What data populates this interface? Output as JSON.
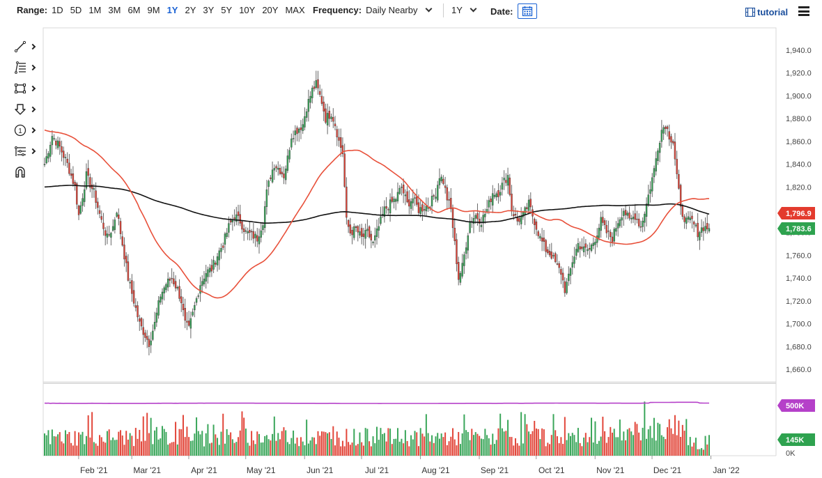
{
  "toolbar": {
    "range_label": "Range:",
    "ranges": [
      "1D",
      "5D",
      "1M",
      "3M",
      "6M",
      "9M",
      "1Y",
      "2Y",
      "3Y",
      "5Y",
      "10Y",
      "20Y",
      "MAX"
    ],
    "active_range": "1Y",
    "frequency_label": "Frequency:",
    "frequency_value": "Daily Nearby",
    "period_value": "1Y",
    "date_label": "Date:",
    "tutorial_label": "tutorial"
  },
  "drawing_tools": [
    "line-tool-icon",
    "fibonacci-tool-icon",
    "rectangle-tool-icon",
    "arrow-down-tool-icon",
    "annotation-tool-icon",
    "pitchfork-tool-icon",
    "magnet-tool-icon"
  ],
  "chart_data": {
    "type": "candlestick",
    "y_axis": {
      "min": 1660,
      "max": 1940,
      "ticks": [
        "1,660.0",
        "1,680.0",
        "1,700.0",
        "1,720.0",
        "1,740.0",
        "1,760.0",
        "1,780.0",
        "1,800.0",
        "1,820.0",
        "1,840.0",
        "1,860.0",
        "1,880.0",
        "1,900.0",
        "1,920.0",
        "1,940.0"
      ],
      "tick_values": [
        1660,
        1680,
        1700,
        1720,
        1740,
        1760,
        1780,
        1800,
        1820,
        1840,
        1860,
        1880,
        1900,
        1920,
        1940
      ]
    },
    "x_axis": {
      "labels": [
        "Feb '21",
        "Mar '21",
        "Apr '21",
        "May '21",
        "Jun '21",
        "Jul '21",
        "Aug '21",
        "Sep '21",
        "Oct '21",
        "Nov '21",
        "Dec '21",
        "Jan '22"
      ]
    },
    "price_anchors": [
      [
        0,
        1840
      ],
      [
        4,
        1865
      ],
      [
        8,
        1855
      ],
      [
        12,
        1840
      ],
      [
        16,
        1820
      ],
      [
        18,
        1795
      ],
      [
        22,
        1830
      ],
      [
        26,
        1815
      ],
      [
        30,
        1790
      ],
      [
        33,
        1775
      ],
      [
        36,
        1785
      ],
      [
        38,
        1800
      ],
      [
        41,
        1770
      ],
      [
        44,
        1740
      ],
      [
        47,
        1720
      ],
      [
        50,
        1700
      ],
      [
        53,
        1690
      ],
      [
        55,
        1683
      ],
      [
        58,
        1700
      ],
      [
        61,
        1725
      ],
      [
        64,
        1735
      ],
      [
        67,
        1740
      ],
      [
        70,
        1730
      ],
      [
        72,
        1720
      ],
      [
        74,
        1700
      ],
      [
        76,
        1695
      ],
      [
        79,
        1715
      ],
      [
        82,
        1735
      ],
      [
        85,
        1745
      ],
      [
        88,
        1748
      ],
      [
        91,
        1760
      ],
      [
        94,
        1770
      ],
      [
        97,
        1785
      ],
      [
        100,
        1795
      ],
      [
        103,
        1790
      ],
      [
        106,
        1780
      ],
      [
        109,
        1778
      ],
      [
        112,
        1775
      ],
      [
        115,
        1790
      ],
      [
        117,
        1815
      ],
      [
        119,
        1830
      ],
      [
        121,
        1840
      ],
      [
        124,
        1835
      ],
      [
        126,
        1830
      ],
      [
        128,
        1845
      ],
      [
        130,
        1865
      ],
      [
        133,
        1870
      ],
      [
        136,
        1875
      ],
      [
        138,
        1890
      ],
      [
        141,
        1905
      ],
      [
        143,
        1910
      ],
      [
        146,
        1895
      ],
      [
        148,
        1880
      ],
      [
        151,
        1885
      ],
      [
        153,
        1875
      ],
      [
        155,
        1860
      ],
      [
        157,
        1850
      ],
      [
        159,
        1790
      ],
      [
        161,
        1780
      ],
      [
        164,
        1783
      ],
      [
        167,
        1775
      ],
      [
        170,
        1780
      ],
      [
        173,
        1770
      ],
      [
        176,
        1785
      ],
      [
        179,
        1800
      ],
      [
        182,
        1805
      ],
      [
        185,
        1810
      ],
      [
        188,
        1820
      ],
      [
        191,
        1805
      ],
      [
        194,
        1810
      ],
      [
        197,
        1800
      ],
      [
        200,
        1802
      ],
      [
        203,
        1805
      ],
      [
        206,
        1815
      ],
      [
        208,
        1830
      ],
      [
        210,
        1825
      ],
      [
        212,
        1810
      ],
      [
        214,
        1800
      ],
      [
        216,
        1770
      ],
      [
        218,
        1740
      ],
      [
        220,
        1750
      ],
      [
        222,
        1770
      ],
      [
        224,
        1790
      ],
      [
        227,
        1795
      ],
      [
        230,
        1790
      ],
      [
        233,
        1800
      ],
      [
        236,
        1815
      ],
      [
        239,
        1815
      ],
      [
        242,
        1825
      ],
      [
        244,
        1830
      ],
      [
        246,
        1800
      ],
      [
        249,
        1790
      ],
      [
        252,
        1795
      ],
      [
        255,
        1805
      ],
      [
        258,
        1790
      ],
      [
        261,
        1775
      ],
      [
        264,
        1765
      ],
      [
        267,
        1760
      ],
      [
        270,
        1750
      ],
      [
        272,
        1745
      ],
      [
        274,
        1730
      ],
      [
        276,
        1740
      ],
      [
        278,
        1755
      ],
      [
        281,
        1770
      ],
      [
        284,
        1765
      ],
      [
        287,
        1765
      ],
      [
        290,
        1775
      ],
      [
        293,
        1790
      ],
      [
        296,
        1780
      ],
      [
        299,
        1775
      ],
      [
        302,
        1790
      ],
      [
        305,
        1800
      ],
      [
        308,
        1790
      ],
      [
        311,
        1795
      ],
      [
        314,
        1785
      ],
      [
        317,
        1805
      ],
      [
        319,
        1820
      ],
      [
        321,
        1835
      ],
      [
        323,
        1855
      ],
      [
        325,
        1870
      ],
      [
        327,
        1875
      ],
      [
        329,
        1865
      ],
      [
        331,
        1860
      ],
      [
        333,
        1830
      ],
      [
        335,
        1800
      ],
      [
        338,
        1790
      ],
      [
        341,
        1790
      ],
      [
        344,
        1780
      ],
      [
        347,
        1785
      ],
      [
        350,
        1783.6
      ]
    ],
    "last_price_label": "1,783.6",
    "ma_label": "1,796.9",
    "volume_labels": {
      "ma": "500K",
      "current": "145K"
    },
    "volume_range": [
      0,
      600000
    ],
    "colors": {
      "up": "#3aa65a",
      "down": "#e2463a",
      "ma_fast": "#e8503a",
      "ma_slow": "#111111",
      "volume_ma": "#b540c9"
    }
  }
}
